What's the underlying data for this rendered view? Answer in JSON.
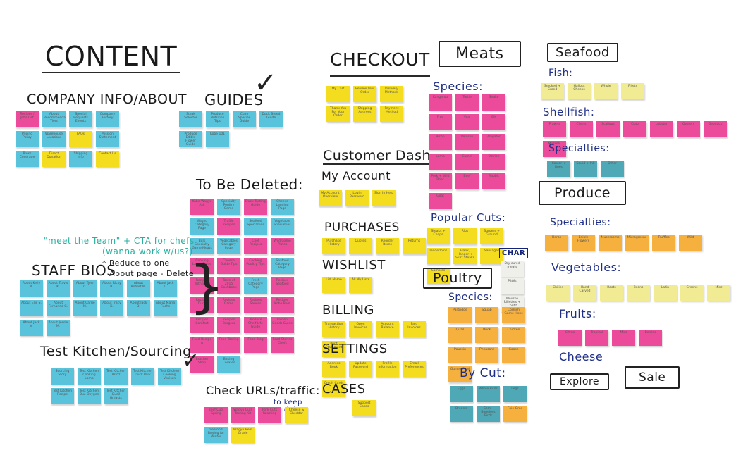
{
  "board": {
    "title": "CONTENT",
    "sections": {
      "company_info": {
        "heading": "COMPANY INFO/ABOUT",
        "notes": [
          {
            "text": "Recipes / Jobs List",
            "color": "pink"
          },
          {
            "text": "About Recommendation Tiers",
            "color": "cyan"
          },
          {
            "text": "Special Requests Events",
            "color": "cyan"
          },
          {
            "text": "Company History",
            "color": "cyan"
          },
          {
            "text": "Pricing Policy",
            "color": "cyan"
          },
          {
            "text": "Warehouse Locations",
            "color": "cyan"
          },
          {
            "text": "FAQs",
            "color": "yel"
          },
          {
            "text": "Mission Statement",
            "color": "cyan"
          },
          {
            "text": "Press Coverage",
            "color": "cyan"
          },
          {
            "text": "Direct Donation",
            "color": "yel"
          },
          {
            "text": "Shipping Info",
            "color": "cyan"
          },
          {
            "text": "Contact Us",
            "color": "yel"
          }
        ]
      },
      "guides": {
        "heading": "GUIDES",
        "check": "✓",
        "notes": [
          {
            "text": "Steak Selector",
            "color": "cyan"
          },
          {
            "text": "Produce Nutrition Tips",
            "color": "cyan"
          },
          {
            "text": "Clam Species Guide",
            "color": "cyan"
          },
          {
            "text": "Duck Breed Guide",
            "color": "cyan"
          },
          {
            "text": "Produce Edible Flower Guide",
            "color": "cyan"
          },
          {
            "text": "Kobe 101",
            "color": "cyan"
          }
        ]
      },
      "to_be_deleted": {
        "heading": "To Be Deleted:",
        "notes": [
          {
            "text": "Kobe Wagyu Ask",
            "color": "pink"
          },
          {
            "text": "Specialty Poultry Game",
            "color": "cyan"
          },
          {
            "text": "Duck Tasting Guide",
            "color": "pink"
          },
          {
            "text": "Cheese Landing Page",
            "color": "cyan"
          },
          {
            "text": "Wagyu Category Page",
            "color": "cyan"
          },
          {
            "text": "Truffle Recipes",
            "color": "pink"
          },
          {
            "text": "Seafood Specialties",
            "color": "cyan"
          },
          {
            "text": "Vegetable Specialties",
            "color": "cyan"
          },
          {
            "text": "Bulk Specialty Game Meats",
            "color": "cyan"
          },
          {
            "text": "Vegetables Category Page",
            "color": "cyan"
          },
          {
            "text": "Chef Recipes",
            "color": "pink"
          },
          {
            "text": "Wild Game Plates",
            "color": "pink"
          },
          {
            "text": "Cooking Lamb Guide",
            "color": "pink"
          },
          {
            "text": "Cheese Guide Tips",
            "color": "pink"
          },
          {
            "text": "Cooking Poultry Tips",
            "color": "pink"
          },
          {
            "text": "Seafood Category Page",
            "color": "cyan"
          },
          {
            "text": "Recipes With Beef",
            "color": "pink"
          },
          {
            "text": "Taste of 2015 Cookbook",
            "color": "pink"
          },
          {
            "text": "Fresh Category Page",
            "color": "cyan"
          },
          {
            "text": "Recipes Seafood",
            "color": "pink"
          },
          {
            "text": "Recipes Duck",
            "color": "pink"
          },
          {
            "text": "Recipes Game",
            "color": "pink"
          },
          {
            "text": "Recipes Sauces",
            "color": "pink"
          },
          {
            "text": "Recipes Kobe Beef",
            "color": "pink"
          },
          {
            "text": "Recipes Comfort",
            "color": "pink"
          },
          {
            "text": "Recipes Burgers",
            "color": "pink"
          },
          {
            "text": "Produce Shelf Life Guide",
            "color": "pink"
          },
          {
            "text": "Frozen Goods Guide",
            "color": "pink"
          },
          {
            "text": "Food Recipe A",
            "color": "pink"
          },
          {
            "text": "Food Tasting",
            "color": "pink"
          },
          {
            "text": "Food Blog",
            "color": "pink"
          },
          {
            "text": "Food Stories Chefs",
            "color": "pink"
          },
          {
            "text": "Butcher Shop",
            "color": "pink"
          },
          {
            "text": "Baking Cookies",
            "color": "cyan"
          }
        ]
      },
      "staff_bios": {
        "heading": "STAFF BIOS",
        "annotation_teal_1": "\"meet the Team\" + CTA for chefs",
        "annotation_teal_2": "(wanna work w/us?)",
        "annotation_black_1": "* Reduce to one",
        "annotation_black_2": "About page - Delete",
        "notes": [
          "About Kelly M.",
          "About Travis K.",
          "About Tyler C.",
          "About Ricky B.",
          "About Robert M.",
          "About Jack L.",
          "About Eric S.",
          "About Fernando G.",
          "About Carrie M.",
          "About Tracy K.",
          "About Jack D.",
          "About Maria Fuchs",
          "About Jack V.",
          "About Jessie M."
        ]
      },
      "test_kitchen": {
        "heading": "Test Kitchen/Sourcing",
        "check": "✓",
        "notes": [
          "Sourcing Story",
          "Test Kitchen Cooking Lamb",
          "Test Kitchen Arroz",
          "Test Kitchen Duck Pork",
          "Test Kitchen Cooking Venison",
          "Test Kitchen Recipe",
          "Test Kitchen Duo Oxygen",
          "Test Kitchen Quail Breasts"
        ]
      },
      "check_urls": {
        "heading": "Check URLs/traffic:",
        "annotation": "to keep or delete",
        "notes": [
          {
            "text": "Beef Cuts Spring",
            "color": "pink"
          },
          {
            "text": "Wagyu Cuts Tasting Kit",
            "color": "pink"
          },
          {
            "text": "Pork Cuts Roasting",
            "color": "pink"
          },
          {
            "text": "Cheese & Cheddar",
            "color": "yel"
          },
          {
            "text": "Seafood Buying for Winter",
            "color": "cyan"
          },
          {
            "text": "Wagyu Beef Grade",
            "color": "yel"
          }
        ]
      },
      "checkout": {
        "heading": "CHECKOUT",
        "notes": [
          "My Cart",
          "Review Your Order",
          "Delivery Methods",
          "Thank You For Your Order",
          "Shipping Address",
          "Payment Method"
        ]
      },
      "customer_dash": {
        "heading": "Customer Dash",
        "my_account": {
          "heading": "My Account",
          "notes": [
            "My Account Overview",
            "Login Password",
            "Sign In Help"
          ]
        },
        "purchases": {
          "heading": "PURCHASES",
          "notes": [
            "Purchase History",
            "Quotes",
            "Reorder Items",
            "Returns"
          ]
        },
        "wishlist": {
          "heading": "WISHLIST",
          "notes": [
            "List Name",
            "All My Lists"
          ]
        },
        "billing": {
          "heading": "BILLING",
          "notes": [
            "Transaction History",
            "Open Invoices",
            "Account Balance",
            "Paid Invoices",
            "Print Statement"
          ]
        },
        "settings": {
          "heading": "SETTINGS",
          "notes": [
            "Address Book",
            "Update Password",
            "Profile Information",
            "Email Preferences",
            "Credit Cards"
          ]
        },
        "cases": {
          "heading": "CASES",
          "notes": [
            "Support Cases"
          ]
        }
      },
      "meats": {
        "heading": "Meats",
        "species_heading": "Species:",
        "species": [
          "Kangaroo",
          "Turtle",
          "Snake",
          "Frog",
          "Veal",
          "Elk",
          "Bison",
          "Venison",
          "Alligator",
          "Lamb",
          "Camel",
          "Ostrich",
          "Pork + Wild Boar",
          "Beef",
          "Rabbit",
          "Goat"
        ],
        "popular_cuts_heading": "Popular Cuts:",
        "popular_cuts": [
          "Steaks + Chops",
          "Ribs",
          "Burgers + Ground",
          "Tenderloins",
          "Flank, Hanger + Skirt Steaks",
          "Sausages",
          "Samples"
        ],
        "charc_label": "CHAR",
        "charc_notes": [
          "Dry cured meats",
          "Pâtés",
          "Mousse Rillettes + Confit"
        ]
      },
      "poultry": {
        "heading": "Poultry",
        "species_heading": "Species:",
        "species": [
          "Partridge",
          "Squab",
          "Cornish Game Hens",
          "Quail",
          "Duck",
          "Chicken",
          "Poussin",
          "Pheasant",
          "Goose",
          "Guinea Fowl"
        ],
        "by_cut_heading": "By Cut:",
        "by_cut": [
          {
            "text": "Eggs",
            "color": "tealn"
          },
          {
            "text": "Whole Birds",
            "color": "tealn"
          },
          {
            "text": "Legs",
            "color": "tealn"
          },
          {
            "text": "Breasts",
            "color": "tealn"
          },
          {
            "text": "Semi-Boneless Birds",
            "color": "tealn"
          },
          {
            "text": "Foie Gras",
            "color": "org"
          }
        ]
      },
      "seafood": {
        "heading": "Seafood",
        "fish_heading": "Fish:",
        "fish": [
          "Smoked + Cured",
          "Halibut Cheeks",
          "Whole",
          "Fillets"
        ],
        "shellfish_heading": "Shellfish:",
        "shellfish": [
          "Prawns",
          "Clams",
          "Scallops",
          "Crab",
          "Lobster",
          "Oysters",
          "Geoduck",
          "Mussels"
        ],
        "specialties_heading": "Specialties:",
        "specialties": [
          "Caviar + Roes",
          "Squid + Ink",
          "Other"
        ]
      },
      "produce": {
        "heading": "Produce",
        "specialties_heading": "Specialties:",
        "specialties": [
          "Herbs",
          "Edible Flowers",
          "Mushrooms",
          "Microgreens",
          "Truffles",
          "Wild"
        ],
        "vegetables_heading": "Vegetables:",
        "vegetables": [
          "Chilies",
          "Hand Carved",
          "Roots",
          "Beans",
          "Latin",
          "Greens",
          "Misc"
        ],
        "fruits_heading": "Fruits:",
        "fruits": [
          "Citrus",
          "Tropical",
          "Misc",
          "Berries"
        ]
      },
      "cheese": {
        "heading": "Cheese"
      },
      "explore": {
        "label": "Explore"
      },
      "sale": {
        "label": "Sale"
      }
    }
  }
}
